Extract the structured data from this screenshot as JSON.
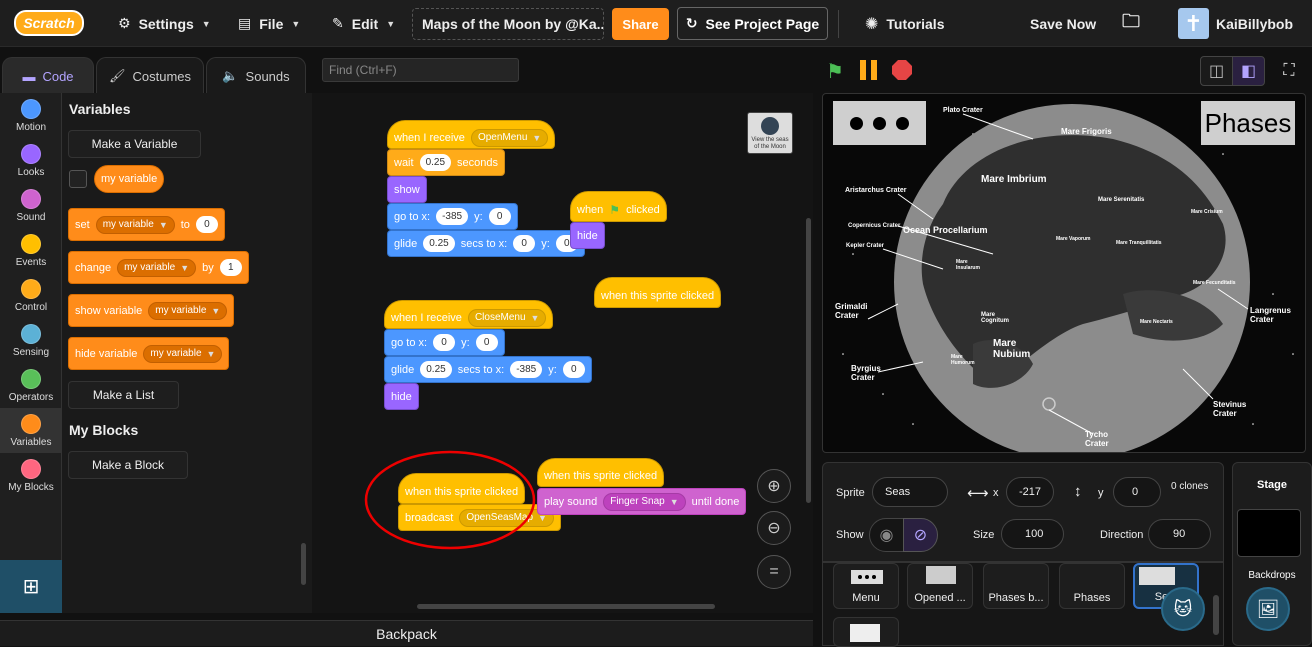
{
  "menubar": {
    "logo": "Scratch",
    "settings": "Settings",
    "file": "File",
    "edit": "Edit",
    "project_title": "Maps of the Moon by @Ka...",
    "share": "Share",
    "see_project": "See Project Page",
    "tutorials": "Tutorials",
    "save_now": "Save Now",
    "username": "KaiBillybob"
  },
  "tabs": {
    "code": "Code",
    "costumes": "Costumes",
    "sounds": "Sounds"
  },
  "find": {
    "placeholder": "Find (Ctrl+F)"
  },
  "categories": [
    {
      "label": "Motion",
      "color": "#4c97ff"
    },
    {
      "label": "Looks",
      "color": "#9966ff"
    },
    {
      "label": "Sound",
      "color": "#cf63cf"
    },
    {
      "label": "Events",
      "color": "#ffbf00"
    },
    {
      "label": "Control",
      "color": "#ffab19"
    },
    {
      "label": "Sensing",
      "color": "#5cb1d6"
    },
    {
      "label": "Operators",
      "color": "#59c059"
    },
    {
      "label": "Variables",
      "color": "#ff8c1a"
    },
    {
      "label": "My Blocks",
      "color": "#ff6680"
    }
  ],
  "palette": {
    "variables_heading": "Variables",
    "make_variable": "Make a Variable",
    "my_variable": "my variable",
    "set": "set",
    "to": "to",
    "set_val": "0",
    "change": "change",
    "by": "by",
    "change_val": "1",
    "show_variable": "show variable",
    "hide_variable": "hide variable",
    "make_list": "Make a List",
    "myblocks_heading": "My Blocks",
    "make_block": "Make a Block"
  },
  "scripts": {
    "s1": {
      "hat": "when I receive",
      "msg": "OpenMenu",
      "wait": "wait",
      "wait_val": "0.25",
      "seconds": "seconds",
      "show": "show",
      "goto": "go to x:",
      "gx": "-385",
      "y": "y:",
      "gy": "0",
      "glide": "glide",
      "gl_t": "0.25",
      "secs_to": "secs to x:",
      "glx": "0",
      "gly": "0"
    },
    "s2": {
      "hat": "when",
      "clicked": "clicked",
      "hide": "hide"
    },
    "s3": {
      "hat": "when this sprite clicked"
    },
    "s4": {
      "hat": "when I receive",
      "msg": "CloseMenu",
      "goto": "go to x:",
      "gx": "0",
      "y": "y:",
      "gy": "0",
      "glide": "glide",
      "gl_t": "0.25",
      "secs_to": "secs to x:",
      "glx": "-385",
      "gly": "0",
      "hide": "hide"
    },
    "s5": {
      "hat": "when this sprite clicked",
      "broadcast": "broadcast",
      "msg": "OpenSeasMap"
    },
    "s6": {
      "hat": "when this sprite clicked",
      "play": "play sound",
      "sound": "Finger Snap",
      "until": "until done"
    },
    "sprite_thumb": "View the seas of the Moon"
  },
  "backpack": "Backpack",
  "stage": {
    "phases": "Phases",
    "labels": {
      "plato": "Plato Crater",
      "frigoris": "Mare Frigoris",
      "imbrium": "Mare Imbrium",
      "aristarchus": "Aristarchus Crater",
      "serenitatis": "Mare Serenitatis",
      "crisium": "Mare Crisium",
      "procellarum": "Ocean Procellarium",
      "copernicus": "Copernicus Crater",
      "vaporum": "Mare Vaporum",
      "tranquillitatis": "Mare Tranquillitatis",
      "kepler": "Kepler Crater",
      "insularum": "Mare Insularum",
      "fecunditatis": "Mare Fecunditatis",
      "grimaldi": "Grimaldi Crater",
      "langrenus": "Langrenus Crater",
      "cognitum": "Mare Cognitum",
      "nectaris": "Mare Nectaris",
      "nubium": "Mare Nubium",
      "humorum": "Mare Humorum",
      "byrgius": "Byrgius Crater",
      "stevinus": "Stevinus Crater",
      "tycho": "Tycho Crater"
    }
  },
  "sprite": {
    "sprite_label": "Sprite",
    "name": "Seas",
    "x_label": "x",
    "x": "-217",
    "y_label": "y",
    "y": "0",
    "clones": "0 clones",
    "show_label": "Show",
    "size_label": "Size",
    "size": "100",
    "direction_label": "Direction",
    "direction": "90"
  },
  "sprites": [
    "Menu",
    "Opened ...",
    "Phases b...",
    "Phases",
    "Se..."
  ],
  "stage_panel": {
    "title": "Stage",
    "backdrops": "Backdrops"
  }
}
